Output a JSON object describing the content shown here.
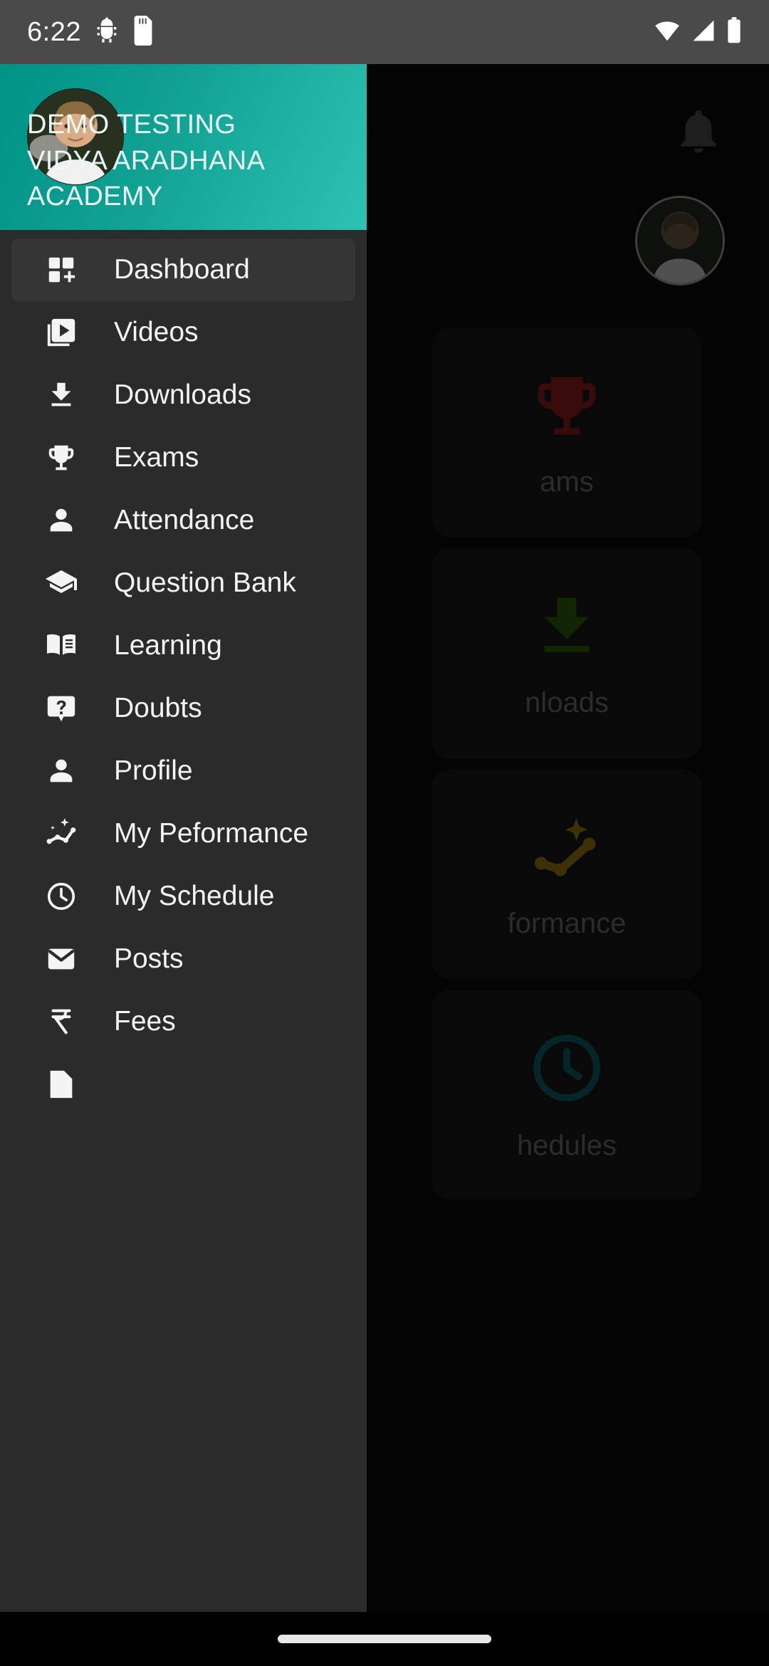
{
  "status_bar": {
    "time": "6:22",
    "icons_left": [
      "android-debug-icon",
      "sd-card-icon"
    ],
    "icons_right": [
      "wifi-icon",
      "cellular-signal-icon",
      "battery-icon"
    ]
  },
  "drawer": {
    "header": {
      "user_name": "DEMO TESTING",
      "organization": "VIDYA ARADHANA ACADEMY",
      "avatar": "user-avatar-photo",
      "gradient_start": "#009285",
      "gradient_end": "#2ec2b2"
    },
    "selected_item": "Dashboard",
    "items": [
      {
        "label": "Dashboard",
        "icon": "dashboard-customize-icon",
        "selected": true
      },
      {
        "label": "Videos",
        "icon": "video-library-icon",
        "selected": false
      },
      {
        "label": "Downloads",
        "icon": "download-icon",
        "selected": false
      },
      {
        "label": "Exams",
        "icon": "trophy-icon",
        "selected": false
      },
      {
        "label": "Attendance",
        "icon": "person-icon",
        "selected": false
      },
      {
        "label": "Question Bank",
        "icon": "graduation-cap-icon",
        "selected": false
      },
      {
        "label": "Learning",
        "icon": "open-book-icon",
        "selected": false
      },
      {
        "label": "Doubts",
        "icon": "question-bubble-icon",
        "selected": false
      },
      {
        "label": "Profile",
        "icon": "person-icon",
        "selected": false
      },
      {
        "label": "My Peformance",
        "icon": "sparkle-chart-icon",
        "selected": false
      },
      {
        "label": "My Schedule",
        "icon": "clock-icon",
        "selected": false
      },
      {
        "label": "Posts",
        "icon": "envelope-icon",
        "selected": false
      },
      {
        "label": "Fees",
        "icon": "rupee-icon",
        "selected": false
      }
    ]
  },
  "background": {
    "bell_icon": "notification-bell-icon",
    "avatar": "user-avatar-photo",
    "cards": [
      {
        "label": "Exams",
        "label_visible": "ams",
        "icon": "trophy-icon",
        "color": "#a32020"
      },
      {
        "label": "Downloads",
        "label_visible": "nloads",
        "icon": "download-icon",
        "color": "#2f6b06"
      },
      {
        "label": "Performance",
        "label_visible": "formance",
        "icon": "sparkle-chart-icon",
        "color": "#b08a10"
      },
      {
        "label": "Schedules",
        "label_visible": "hedules",
        "icon": "clock-icon",
        "color": "#116b75"
      }
    ]
  },
  "nav_bar": {
    "gesture_pill": "home-gesture-pill"
  }
}
